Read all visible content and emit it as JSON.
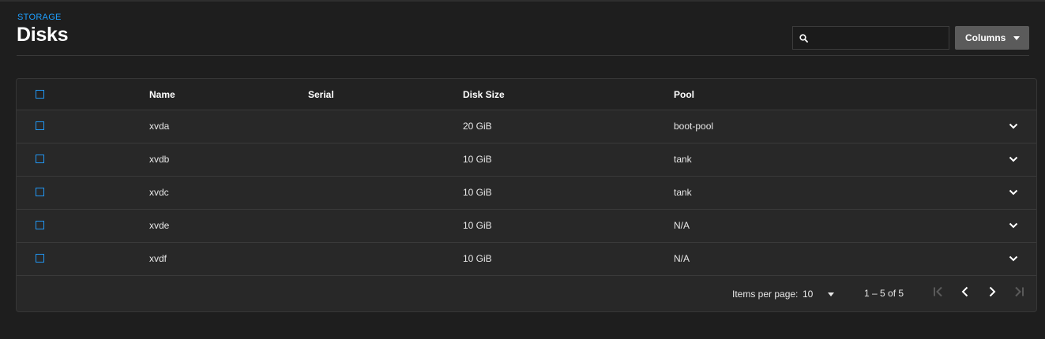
{
  "header": {
    "breadcrumb": "STORAGE",
    "title": "Disks"
  },
  "search": {
    "value": "",
    "placeholder": ""
  },
  "columns_button": {
    "label": "Columns"
  },
  "table": {
    "columns": [
      "Name",
      "Serial",
      "Disk Size",
      "Pool"
    ],
    "rows": [
      {
        "name": "xvda",
        "serial": "",
        "size": "20 GiB",
        "pool": "boot-pool"
      },
      {
        "name": "xvdb",
        "serial": "",
        "size": "10 GiB",
        "pool": "tank"
      },
      {
        "name": "xvdc",
        "serial": "",
        "size": "10 GiB",
        "pool": "tank"
      },
      {
        "name": "xvde",
        "serial": "",
        "size": "10 GiB",
        "pool": "N/A"
      },
      {
        "name": "xvdf",
        "serial": "",
        "size": "10 GiB",
        "pool": "N/A"
      }
    ]
  },
  "paginator": {
    "items_per_page_label": "Items per page:",
    "items_per_page_value": "10",
    "range_label": "1 – 5 of 5"
  },
  "colors": {
    "accent": "#2196f3",
    "background": "#1e1e1e",
    "card": "#282828",
    "button": "#5b5b5b"
  }
}
